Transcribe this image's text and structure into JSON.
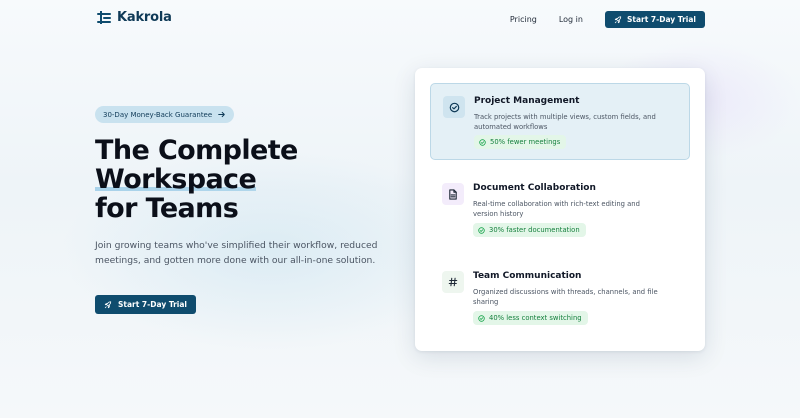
{
  "brand": {
    "name": "Kakrola"
  },
  "nav": {
    "links": [
      "Pricing",
      "Log in"
    ],
    "cta_label": "Start 7-Day Trial"
  },
  "hero": {
    "badge": "30-Day Money-Back Guarantee",
    "title_line1": "The Complete",
    "title_line2": "Workspace",
    "title_line3": "for Teams",
    "subtitle": "Join growing teams who've simplified their workflow, reduced meetings, and gotten more done with our all-in-one solution.",
    "cta_label": "Start 7-Day Trial"
  },
  "features": [
    {
      "title": "Project Management",
      "description": "Track projects with multiple views, custom fields, and automated workflows",
      "metric": "50% fewer meetings",
      "icon": "check-circle-icon"
    },
    {
      "title": "Document Collaboration",
      "description": "Real-time collaboration with rich-text editing and version history",
      "metric": "30% faster documentation",
      "icon": "document-icon"
    },
    {
      "title": "Team Communication",
      "description": "Organized discussions with threads, channels, and file sharing",
      "metric": "40% less context switching",
      "icon": "hash-icon"
    }
  ],
  "colors": {
    "primary": "#0f4c6e",
    "badge_bg": "#c9e2ef",
    "highlight": "#a8d2ea",
    "metric_text": "#15803d",
    "metric_bg": "#e3f6e8"
  }
}
